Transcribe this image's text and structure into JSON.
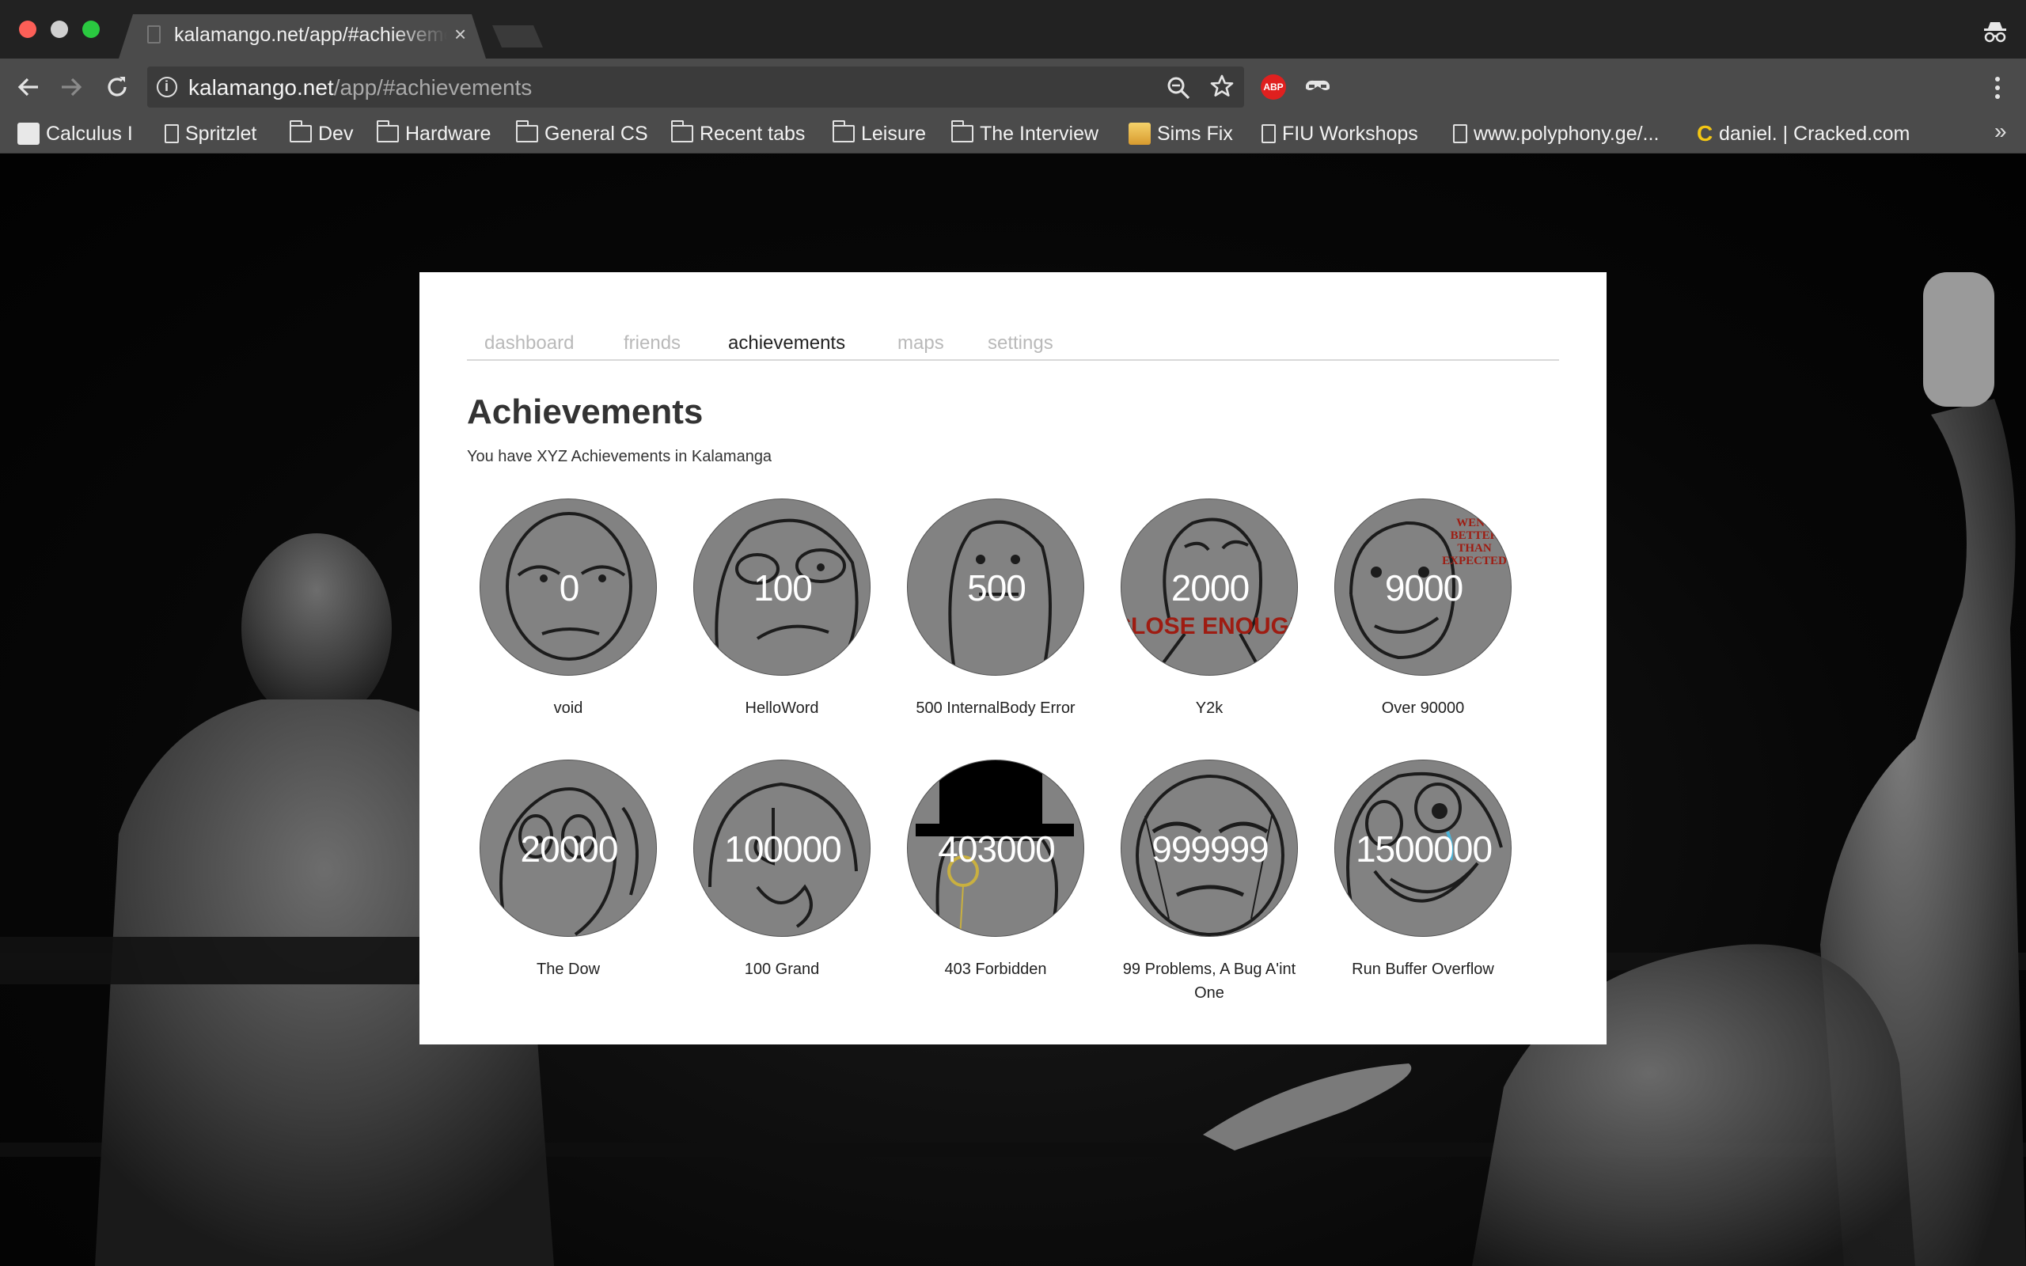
{
  "browser": {
    "tab_title": "kalamango.net/app/#achievements",
    "tab_close": "×",
    "url_host": "kalamango.net",
    "url_path": "/app/#achievements",
    "extensions": {
      "abp_label": "ABP"
    },
    "bookmarks_more": "»",
    "bookmarks": [
      {
        "label": "Calculus I",
        "icon": "apple-icon"
      },
      {
        "label": "Spritzlet",
        "icon": "page-icon"
      },
      {
        "label": "Dev",
        "icon": "folder-icon"
      },
      {
        "label": "Hardware",
        "icon": "folder-icon"
      },
      {
        "label": "General CS",
        "icon": "folder-icon"
      },
      {
        "label": "Recent tabs",
        "icon": "folder-icon"
      },
      {
        "label": "Leisure",
        "icon": "folder-icon"
      },
      {
        "label": "The Interview",
        "icon": "folder-icon"
      },
      {
        "label": "Sims Fix",
        "icon": "sims-icon"
      },
      {
        "label": "FIU Workshops",
        "icon": "page-icon"
      },
      {
        "label": "www.polyphony.ge/...",
        "icon": "page-icon"
      },
      {
        "label": "daniel. | Cracked.com",
        "icon": "cracked-icon",
        "glyph": "C"
      }
    ]
  },
  "colors": {
    "tabstrip": "#222222",
    "toolbar": "#4b4b4b",
    "circle_fill": "#828282",
    "abp_red": "#e0201f",
    "traffic_close": "#fc5f57",
    "traffic_max": "#2ac940"
  },
  "nav": {
    "tabs": [
      {
        "label": "dashboard",
        "active": false
      },
      {
        "label": "friends",
        "active": false
      },
      {
        "label": "achievements",
        "active": true
      },
      {
        "label": "maps",
        "active": false
      },
      {
        "label": "settings",
        "active": false
      }
    ]
  },
  "page": {
    "title": "Achievements",
    "subtitle": "You have XYZ Achievements in Kalamanga"
  },
  "achievements": [
    {
      "number": "0",
      "name": "void"
    },
    {
      "number": "100",
      "name": "HelloWord"
    },
    {
      "number": "500",
      "name": "500 InternalBody Error"
    },
    {
      "number": "2000",
      "name": "Y2k",
      "badge_text": "CLOSE ENOUGH"
    },
    {
      "number": "9000",
      "name": "Over 90000",
      "badge_text": "WENT BETTER THAN EXPECTED"
    },
    {
      "number": "20000",
      "name": "The Dow"
    },
    {
      "number": "100000",
      "name": "100 Grand"
    },
    {
      "number": "403000",
      "name": "403 Forbidden"
    },
    {
      "number": "999999",
      "name": "99 Problems, A Bug A'int One"
    },
    {
      "number": "1500000",
      "name": "Run Buffer Overflow"
    }
  ]
}
